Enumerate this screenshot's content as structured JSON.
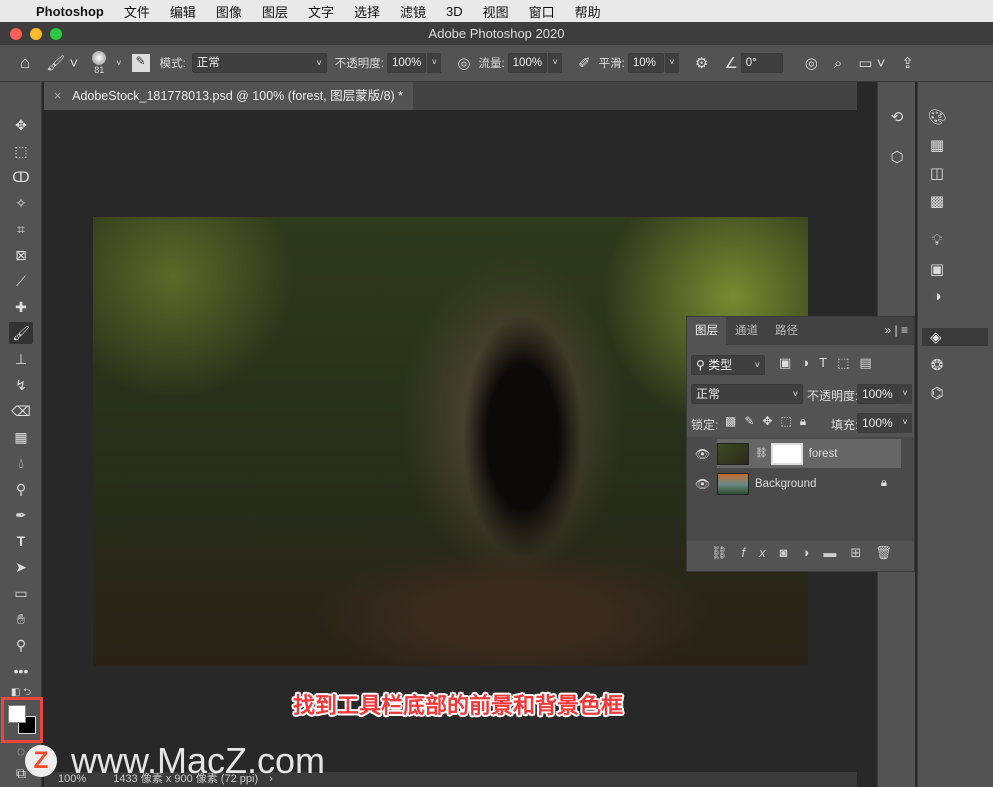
{
  "menubar": {
    "apple": "",
    "items": [
      "Photoshop",
      "文件",
      "编辑",
      "图像",
      "图层",
      "文字",
      "选择",
      "滤镜",
      "3D",
      "视图",
      "窗口",
      "帮助"
    ]
  },
  "window": {
    "title": "Adobe Photoshop 2020"
  },
  "options": {
    "brush_size": "81",
    "mode_label": "模式:",
    "mode_value": "正常",
    "opacity_label": "不透明度:",
    "opacity_value": "100%",
    "flow_label": "流量:",
    "flow_value": "100%",
    "smooth_label": "平滑:",
    "smooth_value": "10%",
    "angle_value": "0°"
  },
  "document": {
    "tab_title": "AdobeStock_181778013.psd @ 100% (forest, 图层蒙版/8) *",
    "close": "×"
  },
  "layers_panel": {
    "tabs": [
      "图层",
      "通道",
      "路径"
    ],
    "filter_label": "类型",
    "blend_mode": "正常",
    "opacity_label": "不透明度:",
    "opacity_value": "100%",
    "lock_label": "锁定:",
    "fill_label": "填充:",
    "fill_value": "100%",
    "layers": [
      {
        "name": "forest"
      },
      {
        "name": "Background"
      }
    ]
  },
  "caption": "找到工具栏底部的前景和背景色框",
  "watermark": "www.MacZ.com",
  "watermark_logo": "Z",
  "status": {
    "zoom": "100%",
    "doc_info": "1433 像素 x 900 像素 (72 ppi)"
  },
  "colors": {
    "foreground": "#ffffff",
    "background": "#000000",
    "highlight": "#e8473d"
  }
}
